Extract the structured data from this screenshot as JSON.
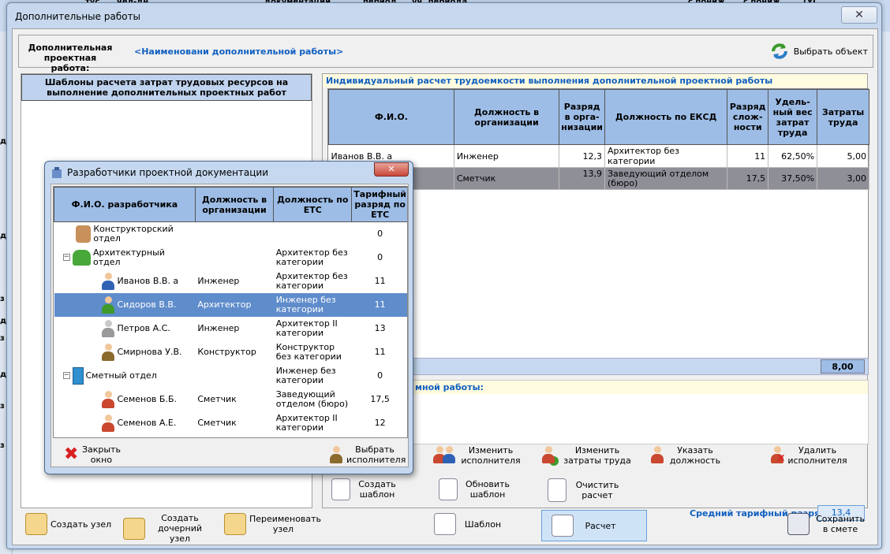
{
  "background": {
    "strip_labels": [
      "тус",
      "чел-дн",
      "документации",
      "период",
      "уч. периода",
      "с пониж.",
      "с пониж.",
      "(УС"
    ],
    "left_labels": [
      "д",
      "д",
      "з",
      "д",
      "з",
      "д",
      "з",
      "з"
    ]
  },
  "window": {
    "title": "Дополнительные работы",
    "close_label": "✕"
  },
  "header": {
    "label": "Дополнительная проектная работа:",
    "name": "<Наименовани дополнительной работы>",
    "select_object_label": "Выбрать объект"
  },
  "left_panel": {
    "title": "Шаблоны расчета затрат трудовых ресурсов на выполнение дополнительных проектных работ"
  },
  "right_panel": {
    "title": "Индивидуальный расчет трудоемкости выполнения дополнительной проектной работы",
    "columns": [
      "Ф.И.О.",
      "Должность в организации",
      "Разряд в орга-низации",
      "Должность по ЕКСД",
      "Разряд слож-ности",
      "Удель-ный вес затрат труда",
      "Затраты труда"
    ],
    "rows": [
      {
        "fio": "Иванов В.В. а",
        "position": "Инженер",
        "rank": "12,3",
        "eksd": "Архитектор без категории",
        "complexity": "11",
        "weight": "62,50%",
        "labor": "5,00"
      },
      {
        "fio": "",
        "position": "Сметчик",
        "rank": "13,9",
        "eksd": "Заведующий отделом (бюро)",
        "complexity": "17,5",
        "weight": "37,50%",
        "labor": "3,00"
      }
    ],
    "total": "8,00",
    "description_title": "мной работы:",
    "avg_label": "Средний тарифный разряд :",
    "avg_value": "13,4"
  },
  "actions": {
    "change_executor": "Изменить исполнителя",
    "change_labor": "Изменить затраты труда",
    "set_position": "Указать должность",
    "delete_executor": "Удалить исполнителя",
    "create_template": "Создать шаблон",
    "update_template": "Обновить шаблон",
    "clear_calc": "Очистить расчет"
  },
  "bottom": {
    "create_node": "Создать узел",
    "create_child": "Создать дочерний узел",
    "rename_node": "Переименовать узел",
    "template": "Шаблон",
    "calc": "Расчет",
    "save": "Сохранить в смете"
  },
  "dialog": {
    "title": "Разработчики проектной документации",
    "close_label": "✕",
    "columns": [
      "Ф.И.О. разработчика",
      "Должность в организации",
      "Должность по ЕТС",
      "Тарифный разряд по ЕТС"
    ],
    "rows": [
      {
        "name": "Конструкторский отдел",
        "position": "",
        "ets": "",
        "rank": "0"
      },
      {
        "name": "Архитектурный отдел",
        "position": "",
        "ets": "Архитектор без категории",
        "rank": "0"
      },
      {
        "name": "Иванов В.В. а",
        "position": "Инженер",
        "ets": "Архитектор без категории",
        "rank": "11"
      },
      {
        "name": "Сидоров В.В.",
        "position": "Архитектор",
        "ets": "Инженер без категории",
        "rank": "11"
      },
      {
        "name": "Петров А.С.",
        "position": "Инженер",
        "ets": "Архитектор II категории",
        "rank": "13"
      },
      {
        "name": "Смирнова У.В.",
        "position": "Конструктор",
        "ets": "Конструктор без категории",
        "rank": "11"
      },
      {
        "name": "Сметный отдел",
        "position": "",
        "ets": "Инженер без категории",
        "rank": "0"
      },
      {
        "name": "Семенов Б.Б.",
        "position": "Сметчик",
        "ets": "Заведующий отделом (бюро)",
        "rank": "17,5"
      },
      {
        "name": "Семенов А.Е.",
        "position": "Сметчик",
        "ets": "Архитектор II категории",
        "rank": "12"
      }
    ],
    "close_window": "Закрыть окно",
    "select_executor": "Выбрать исполнителя"
  },
  "colors": {
    "header_blue": "#9dbde6",
    "highlight": "#5f8ccb",
    "accent_text": "#1060c0"
  }
}
